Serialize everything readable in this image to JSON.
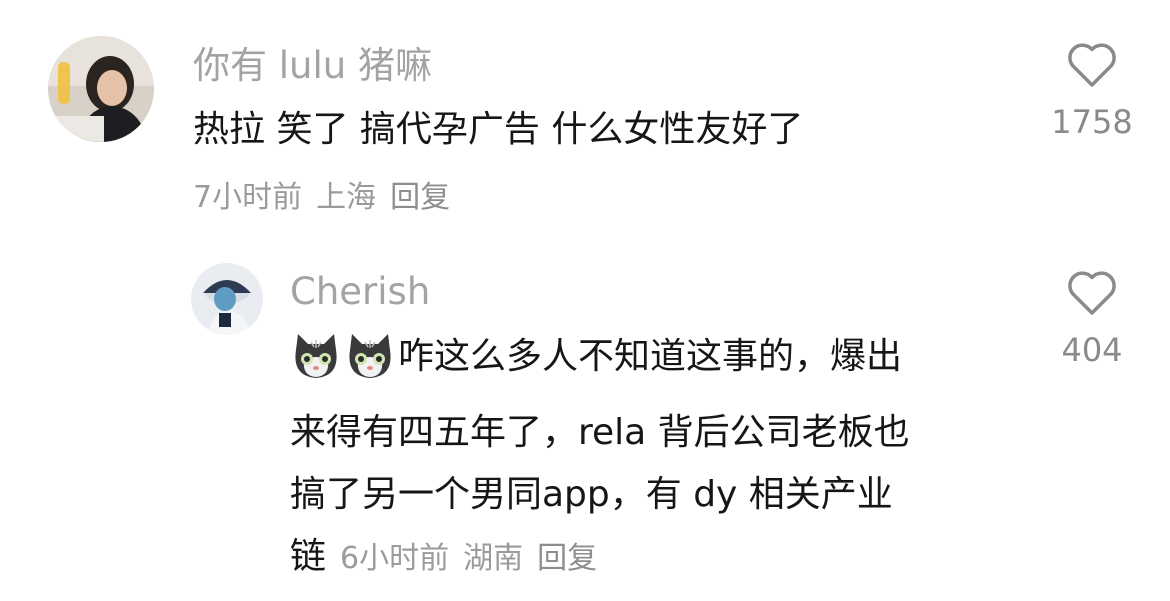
{
  "comment": {
    "username": "你有 lulu 猪嘛",
    "text": "热拉 笑了 搞代孕广告 什么女性友好了",
    "time": "7小时前",
    "location": "上海",
    "reply_label": "回复",
    "likes": "1758"
  },
  "reply": {
    "username": "Cherish",
    "emoji": [
      "cat-emoji",
      "cat-emoji"
    ],
    "text_lines": [
      "咋这么多人不知道这事的，爆出",
      "来得有四五年了，rela 背后公司老板也",
      "搞了另一个男同app，有 dy 相关产业",
      "链"
    ],
    "time": "6小时前",
    "location": "湖南",
    "reply_label": "回复",
    "likes": "404"
  },
  "icons": {
    "like": "heart-outline-icon"
  }
}
